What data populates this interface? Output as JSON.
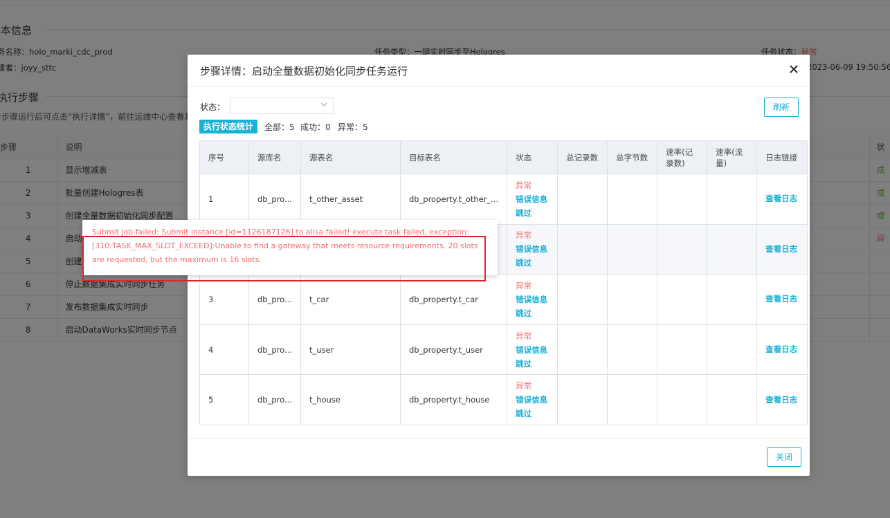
{
  "background": {
    "basic_info_title": "基本信息",
    "task_name": "务名称：holo_marki_cdc_prod",
    "creator": "建者：joyy_sttc",
    "task_type": "任务类型：一键实时同步至Hologres",
    "task_status_label": "任务状态：",
    "task_status_value": "异常",
    "create_time": "2023-06-09 19:50:56",
    "steps_title": "执行步骤",
    "hint": "分步骤运行后可点击“执行详情”，前往运维中心查看具",
    "table_headers": {
      "step": "步骤",
      "desc": "说明",
      "status": "状"
    },
    "steps": [
      {
        "step": "1",
        "desc": "显示增减表",
        "status": "成"
      },
      {
        "step": "2",
        "desc": "批量创建Hologres表",
        "status": "成"
      },
      {
        "step": "3",
        "desc": "创建全量数据初始化同步配置",
        "status": "成"
      },
      {
        "step": "4",
        "desc": "启动",
        "status": "异"
      },
      {
        "step": "5",
        "desc": "创建",
        "status": ""
      },
      {
        "step": "6",
        "desc": "停止数据集成实时同步任务",
        "status": ""
      },
      {
        "step": "7",
        "desc": "发布数据集成实时同步",
        "status": ""
      },
      {
        "step": "8",
        "desc": "启动DataWorks实时同步节点",
        "status": ""
      }
    ]
  },
  "dialog": {
    "title": "步骤详情：启动全量数据初始化同步任务运行",
    "close_icon": "close-icon",
    "filter_label": "状态：",
    "filter_value": "",
    "refresh_label": "刷新",
    "stats_badge": "执行状态统计",
    "stats_total": "全部：5",
    "stats_success": "成功：0",
    "stats_error": "异常：5",
    "columns": [
      "序号",
      "源库名",
      "源表名",
      "目标表名",
      "状态",
      "总记录数",
      "总字节数",
      "速率(记录数)",
      "速率(流量)",
      "日志链接"
    ],
    "rows": [
      {
        "no": "1",
        "src_db": "db_pro...",
        "src_table": "t_other_asset",
        "target": "db_property.t_other_...",
        "status": "异常",
        "err_info": "错误信息",
        "skip": "跳过",
        "total_records": "",
        "total_bytes": "",
        "rate_records": "",
        "rate_flow": "",
        "log": "查看日志"
      },
      {
        "no": "2",
        "src_db": "",
        "src_table": "",
        "target": "",
        "status": "异常",
        "err_info": "错误信息",
        "skip": "跳过",
        "total_records": "",
        "total_bytes": "",
        "rate_records": "",
        "rate_flow": "",
        "log": "查看日志"
      },
      {
        "no": "3",
        "src_db": "db_pro...",
        "src_table": "t_car",
        "target": "db_property.t_car",
        "status": "异常",
        "err_info": "错误信息",
        "skip": "跳过",
        "total_records": "",
        "total_bytes": "",
        "rate_records": "",
        "rate_flow": "",
        "log": "查看日志"
      },
      {
        "no": "4",
        "src_db": "db_pro...",
        "src_table": "t_user",
        "target": "db_property.t_user",
        "status": "异常",
        "err_info": "错误信息",
        "skip": "跳过",
        "total_records": "",
        "total_bytes": "",
        "rate_records": "",
        "rate_flow": "",
        "log": "查看日志"
      },
      {
        "no": "5",
        "src_db": "db_pro...",
        "src_table": "t_house",
        "target": "db_property.t_house",
        "status": "异常",
        "err_info": "错误信息",
        "skip": "跳过",
        "total_records": "",
        "total_bytes": "",
        "rate_records": "",
        "rate_flow": "",
        "log": "查看日志"
      }
    ],
    "close_label": "关闭"
  },
  "tooltip": {
    "message": "Submit job failed: Submit instance [id=1126187126] to alisa failed! execute task failed, exception: [310:TASK_MAX_SLOT_EXCEED]:Unable to find a gateway that meets resource requirements. 20 slots are requested, but the maximum is 16 slots."
  },
  "colors": {
    "accent": "#1ab1d6",
    "error": "#f56c6c",
    "success": "#52c41a",
    "highlight": "#e0242a"
  }
}
